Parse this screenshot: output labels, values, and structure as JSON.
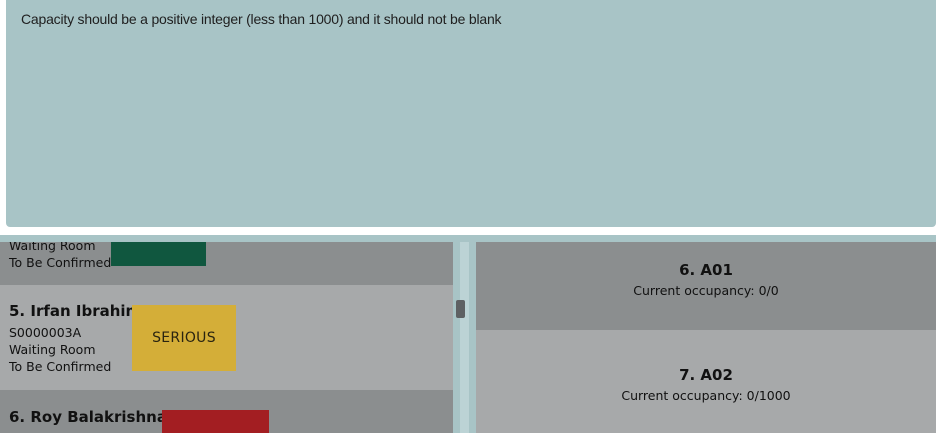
{
  "feedback": {
    "message": "Capacity should be a positive integer (less than 1000) and it should not be blank"
  },
  "patients": [
    {
      "location": "Waiting Room",
      "status": "To Be Confirmed",
      "tag_color": "#10573f"
    },
    {
      "title": "5.  Irfan Ibrahim",
      "id": "S0000003A",
      "location": "Waiting Room",
      "status": "To Be Confirmed",
      "tag": "SERIOUS",
      "tag_color": "#d4ae38"
    },
    {
      "title": "6.  Roy Balakrishnan",
      "tag_color": "#a31e22"
    }
  ],
  "rooms": [
    {
      "title": "6.  A01",
      "occupancy": "Current occupancy: 0/0"
    },
    {
      "title": "7.  A02",
      "occupancy": "Current occupancy: 0/1000"
    }
  ],
  "colors": {
    "feedback_bg": "#a8c4c6",
    "card_dark": "#8b8e8f",
    "card_light": "#a7a9aa"
  }
}
